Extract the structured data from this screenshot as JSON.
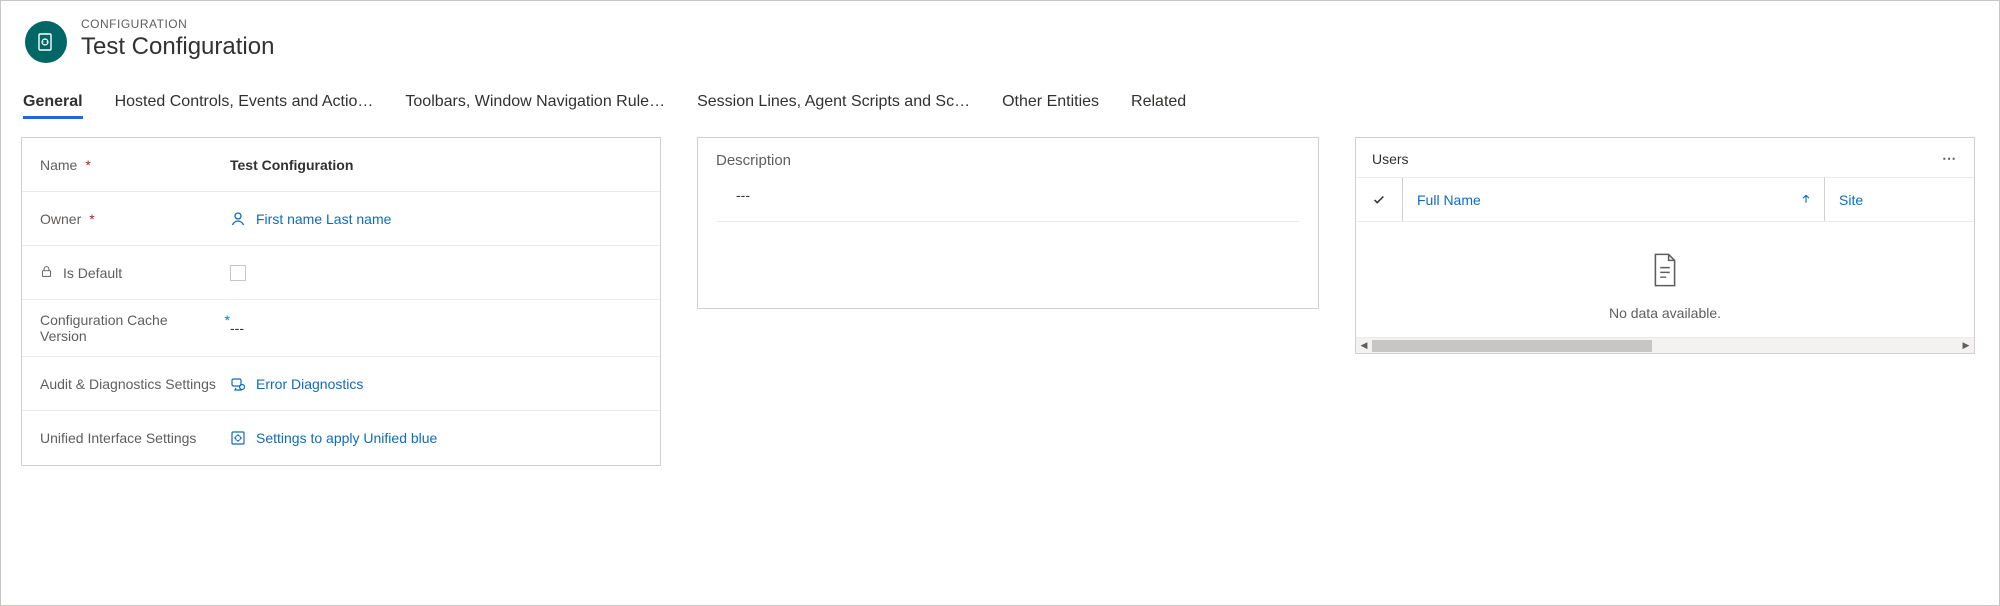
{
  "header": {
    "kicker": "CONFIGURATION",
    "title": "Test Configuration"
  },
  "tabs": [
    {
      "label": "General",
      "active": true
    },
    {
      "label": "Hosted Controls, Events and Actio…",
      "active": false
    },
    {
      "label": "Toolbars, Window Navigation Rule…",
      "active": false
    },
    {
      "label": "Session Lines, Agent Scripts and Sc…",
      "active": false
    },
    {
      "label": "Other Entities",
      "active": false
    },
    {
      "label": "Related",
      "active": false
    }
  ],
  "form": {
    "name": {
      "label": "Name",
      "value": "Test Configuration"
    },
    "owner": {
      "label": "Owner",
      "value": "First name Last name"
    },
    "isDefault": {
      "label": "Is Default"
    },
    "cacheVersion": {
      "label": "Configuration Cache Version",
      "value": "---"
    },
    "audit": {
      "label": "Audit & Diagnostics Settings",
      "value": "Error Diagnostics"
    },
    "unified": {
      "label": "Unified Interface Settings",
      "value": "Settings to apply Unified blue"
    }
  },
  "description": {
    "label": "Description",
    "value": "---"
  },
  "users": {
    "title": "Users",
    "columns": {
      "fullName": "Full Name",
      "site": "Site"
    },
    "empty": "No data available."
  }
}
